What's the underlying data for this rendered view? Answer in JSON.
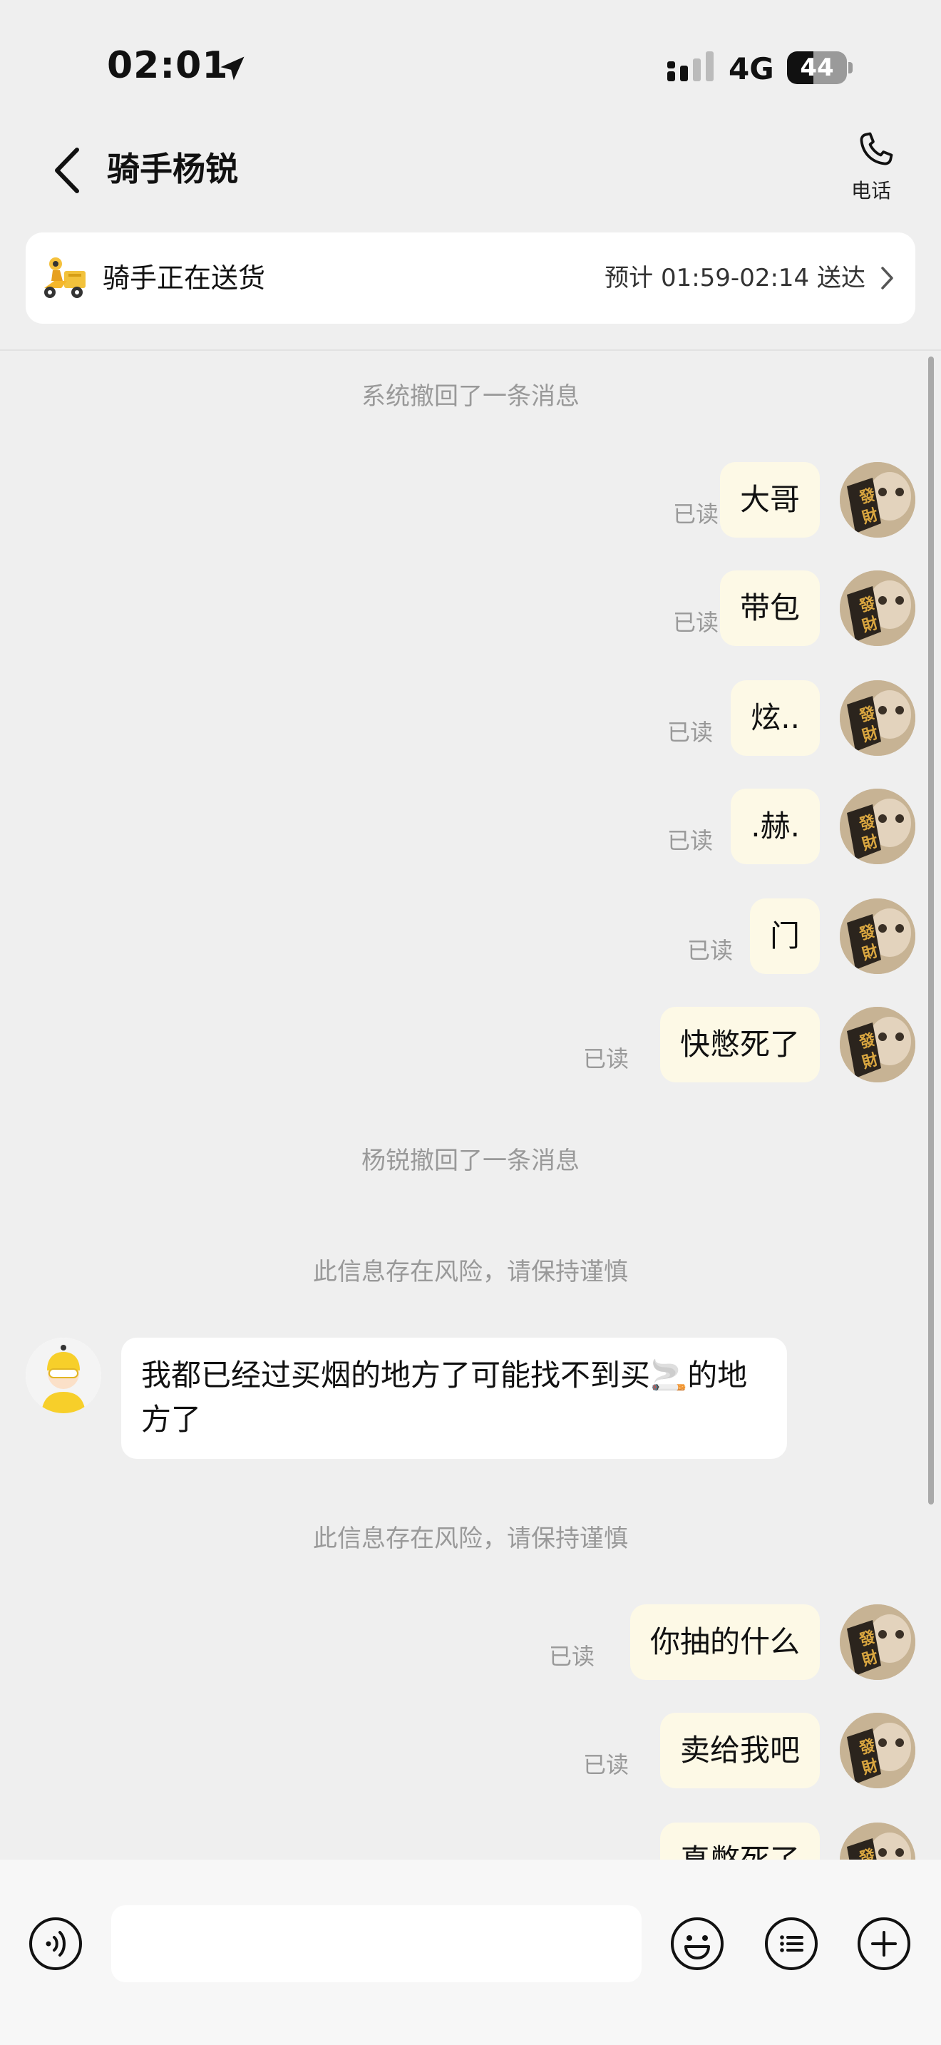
{
  "status_bar": {
    "time": "02:01",
    "network": "4G",
    "battery": "44",
    "battery_level": 0.44
  },
  "nav": {
    "title": "骑手杨锐",
    "call_label": "电话"
  },
  "delivery_card": {
    "status": "骑手正在送货",
    "eta": "预计 01:59-02:14 送达"
  },
  "messages": {
    "system_1": "系统撤回了一条消息",
    "system_2": "杨锐撤回了一条消息",
    "risk_1": "此信息存在风险，请保持谨慎",
    "risk_2": "此信息存在风险，请保持谨慎",
    "read_label": "已读",
    "me": [
      "大哥",
      "带包",
      "炫..",
      ".赫.",
      "门",
      "快憋死了",
      "你抽的什么",
      "卖给我吧",
      "真憋死了"
    ],
    "rider_text": "我都已经过买烟的地方了可能找不到买🚬的地方了"
  },
  "avatar_text": "發財",
  "input": {
    "value": "",
    "placeholder": ""
  }
}
